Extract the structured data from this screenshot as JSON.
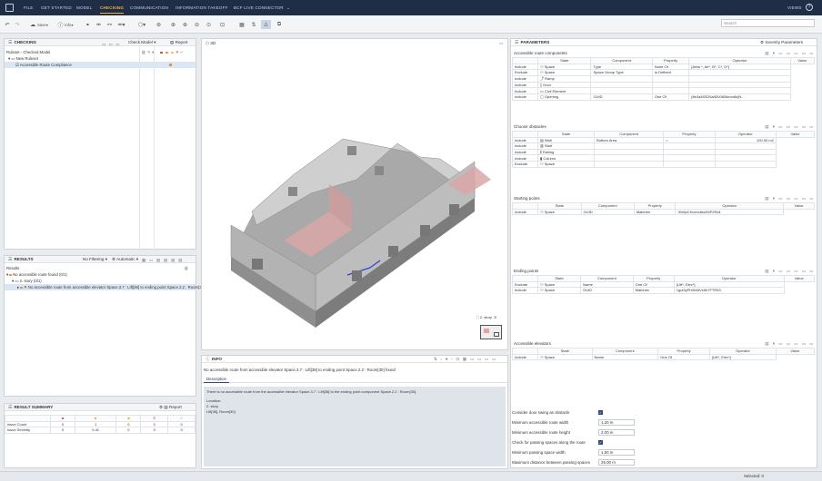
{
  "menu": {
    "items": [
      "FILE",
      "GET STARTED",
      "MODEL",
      "CHECKING",
      "COMMUNICATION",
      "INFORMATION TAKEOFF",
      "BCF LIVE CONNECTOR"
    ],
    "active": "CHECKING",
    "views": "VIEWS"
  },
  "toolbar": {
    "save": "Save",
    "info": "Info",
    "search_placeholder": "Search"
  },
  "checking": {
    "title": "CHECKING",
    "check_model": "Check Model",
    "report": "Report",
    "ruleset": "Ruleset - Checked Model",
    "new_ruleset": "New Ruleset",
    "rule": "Accessible Route Compliance"
  },
  "results": {
    "title": "RESULTS",
    "filter": "No Filtering",
    "auto": "Automatic",
    "results_label": "Results",
    "root": "No accessible route found (0/1)",
    "story": "2. story (0/1)",
    "issue": "No accessible route from accessible elevator Space.3.7 : Lift[38] to ending point Space.2.2 : Room[30]"
  },
  "summary": {
    "title": "RESULT SUMMARY",
    "report": "Report",
    "rows": [
      {
        "label": "Issue Count",
        "vals": [
          "0",
          "1",
          "0",
          "0",
          "0"
        ]
      },
      {
        "label": "Issue Severity",
        "vals": [
          "0",
          "0.41",
          "0",
          "0",
          "0"
        ]
      }
    ],
    "colors": [
      "#c0392b",
      "#e8872c",
      "#f2c12e",
      "#c0392b",
      "#3a9a4a"
    ]
  },
  "viewport": {
    "label": "3D",
    "minimap_label": "2. story"
  },
  "info": {
    "title": "INFO",
    "message": "No accessible route from accessible elevator Space.3.7 : Lift[38] to ending point Space.2.2 : Room[30] found",
    "tab": "Description",
    "desc1": "There is no accessible route from the accessible elevator Space.3.7 : Lift[38] to the ending point component Space.2.2 : Room[30].",
    "location_label": "Location:",
    "loc1": "2. story",
    "loc2": "Lift[38], Room[30]"
  },
  "parameters": {
    "title": "PARAMETERS",
    "severity": "Severity Parameters",
    "route": {
      "title": "Accessible route components",
      "rows": [
        [
          "Include",
          "Space",
          "Type",
          "None Of",
          "[Area *, Air*, B*, C*, D*]"
        ],
        [
          "Exclude",
          "Space",
          "Space Group Type",
          "Is Defined",
          ""
        ],
        [
          "Include",
          "Ramp",
          "",
          "",
          ""
        ],
        [
          "Include",
          "Door",
          "",
          "",
          ""
        ],
        [
          "Include",
          "Civil Element",
          "",
          "",
          ""
        ],
        [
          "Include",
          "Opening",
          "GUID",
          "One Of",
          "[8e3a4f2026a4000606env8o]N..."
        ]
      ]
    },
    "obstacles": {
      "title": "Choose obstacles",
      "rows": [
        [
          "Include",
          "Wall",
          "Bottom Area",
          "=",
          "100.00 m2"
        ],
        [
          "Include",
          "Stair",
          "",
          "",
          ""
        ],
        [
          "Include",
          "Railing",
          "",
          "",
          ""
        ],
        [
          "Include",
          "Column",
          "",
          "",
          ""
        ],
        [
          "Exclude",
          "Space",
          "",
          "",
          ""
        ]
      ]
    },
    "start": {
      "title": "Starting points",
      "rows": [
        [
          "Include",
          "Space",
          "GUID",
          "Matches",
          "30r5pCKuz4c8su59P2Ra1"
        ]
      ]
    },
    "end": {
      "title": "Ending points",
      "rows": [
        [
          "Exclude",
          "Space",
          "Name",
          "One Of",
          "[Lift*, Elev*]"
        ],
        [
          "Include",
          "Space",
          "GUID",
          "Matches",
          "1guI3yPh0N4tVx5h7FTR53"
        ]
      ]
    },
    "elev": {
      "title": "Accessible elevators",
      "rows": [
        [
          "Include",
          "Space",
          "Name",
          "One Of",
          "[Lift*, Elev*]"
        ]
      ]
    },
    "cols": [
      "State",
      "Component",
      "Property",
      "Operator",
      "Value"
    ],
    "settings": [
      {
        "label": "Consider door swing as obstacle",
        "type": "check"
      },
      {
        "label": "Minimum accessible route width",
        "value": "1.20 m"
      },
      {
        "label": "Minimum accessible route height",
        "value": "2.00 m"
      },
      {
        "label": "Check for passing spaces along the route",
        "type": "check"
      },
      {
        "label": "Minimum passing space width",
        "value": "1.50 m"
      },
      {
        "label": "Maximum distance between passing spaces",
        "value": "25.00 m"
      }
    ]
  },
  "status": {
    "selected": "Selected: 0"
  }
}
